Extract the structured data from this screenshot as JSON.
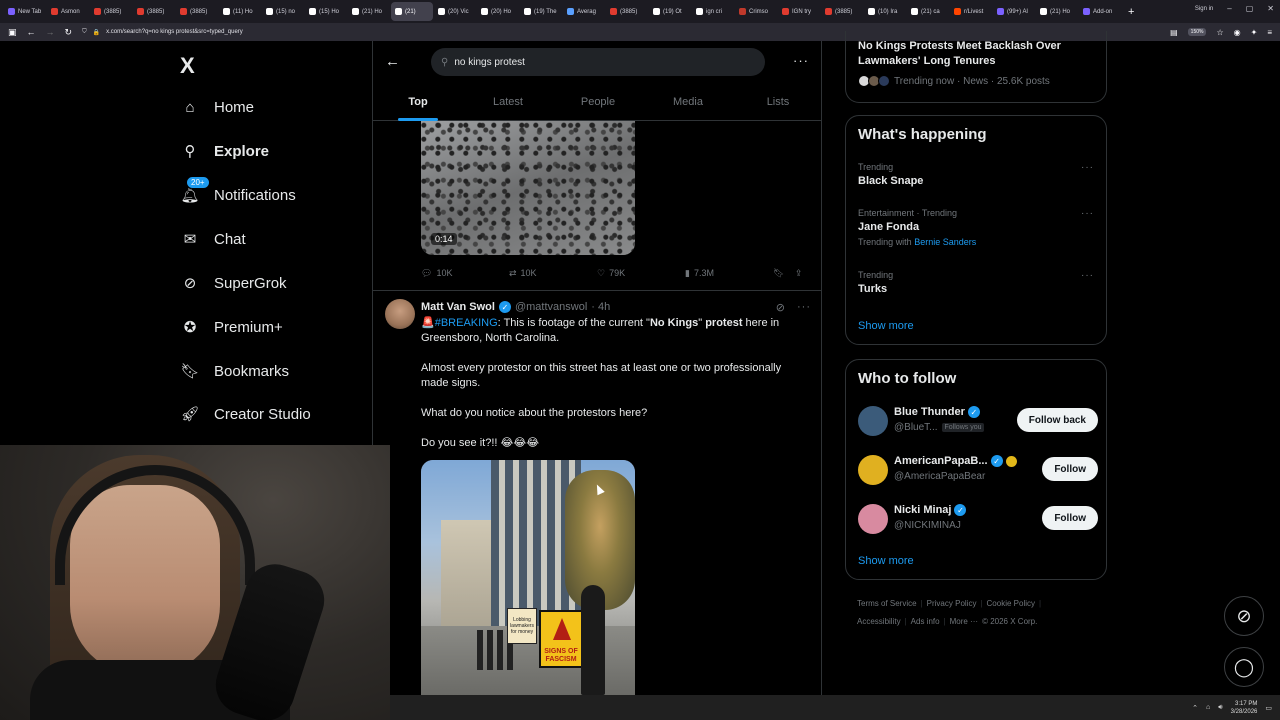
{
  "browser": {
    "tabs": [
      {
        "label": "New Tab",
        "color": "#7b61ff"
      },
      {
        "label": "Asmon",
        "color": "#e03b2f"
      },
      {
        "label": "(3885)",
        "color": "#e03b2f"
      },
      {
        "label": "(3885)",
        "color": "#e03b2f"
      },
      {
        "label": "(3885)",
        "color": "#e03b2f"
      },
      {
        "label": "(11) Ho",
        "color": "#ffffff"
      },
      {
        "label": "(15) no",
        "color": "#ffffff"
      },
      {
        "label": "(15) Ho",
        "color": "#ffffff"
      },
      {
        "label": "(21) Ho",
        "color": "#ffffff"
      },
      {
        "label": "(21)",
        "color": "#ffffff",
        "active": true
      },
      {
        "label": "(20) Vic",
        "color": "#ffffff"
      },
      {
        "label": "(20) Ho",
        "color": "#ffffff"
      },
      {
        "label": "(19) The",
        "color": "#ffffff"
      },
      {
        "label": "Averag",
        "color": "#5aa0ff"
      },
      {
        "label": "(3885)",
        "color": "#e03b2f"
      },
      {
        "label": "(19) Ot",
        "color": "#ffffff"
      },
      {
        "label": "ign cri",
        "color": "#ffffff"
      },
      {
        "label": "Crimso",
        "color": "#c0392b"
      },
      {
        "label": "IGN try",
        "color": "#e03b2f"
      },
      {
        "label": "(3885)",
        "color": "#e03b2f"
      },
      {
        "label": "(10) Ira",
        "color": "#ffffff"
      },
      {
        "label": "(21) ca",
        "color": "#ffffff"
      },
      {
        "label": "r/Livest",
        "color": "#ff4500"
      },
      {
        "label": "(99+) Al",
        "color": "#7b61ff"
      },
      {
        "label": "(21) Ho",
        "color": "#ffffff"
      },
      {
        "label": "Add-on",
        "color": "#7b61ff"
      }
    ],
    "url": "x.com/search?q=no kings protest&src=typed_query",
    "zoom": "150%",
    "signin": "Sign in"
  },
  "nav": {
    "logo": "X",
    "items": [
      {
        "label": "Home",
        "icon": "home-icon"
      },
      {
        "label": "Explore",
        "icon": "search-icon",
        "bold": true
      },
      {
        "label": "Notifications",
        "icon": "bell-icon",
        "badge": "20+"
      },
      {
        "label": "Chat",
        "icon": "mail-icon"
      },
      {
        "label": "SuperGrok",
        "icon": "grok-icon"
      },
      {
        "label": "Premium+",
        "icon": "premium-icon"
      },
      {
        "label": "Bookmarks",
        "icon": "bookmark-icon"
      },
      {
        "label": "Creator Studio",
        "icon": "rocket-icon"
      }
    ]
  },
  "search": {
    "query": "no kings protest",
    "tabs": [
      "Top",
      "Latest",
      "People",
      "Media",
      "Lists"
    ],
    "active_tab": "Top"
  },
  "prev_tweet": {
    "video_time": "0:14",
    "replies": "10K",
    "reposts": "10K",
    "likes": "79K",
    "views": "7.3M"
  },
  "tweet": {
    "name": "Matt Van Swol",
    "handle": "@mattvanswol",
    "time": "· 4h",
    "hashtag": "#BREAKING",
    "line1_a": ": This is footage of the current \"",
    "line1_b": "No Kings",
    "line1_c": "\" ",
    "line1_d": "protest",
    "line1_e": " here in Greensboro, North Carolina.",
    "p2": "Almost every protestor on this street has at least one or two professionally made signs.",
    "p3": "What do you notice about the protestors here?",
    "p4": "Do you see it?!! 😂😂😂",
    "sign_text": "SIGNS OF FASCISM",
    "sign2_text": "Lobbing lawmakers for money"
  },
  "right": {
    "top_trend": {
      "title": "No Kings Protests Meet Backlash Over Lawmakers' Long Tenures",
      "meta": "Trending now · News · 25.6K posts"
    },
    "happening_title": "What's happening",
    "trends": [
      {
        "context": "Trending",
        "name": "Black Snape"
      },
      {
        "context": "Entertainment · Trending",
        "name": "Jane Fonda",
        "with_prefix": "Trending with",
        "with_link": "Bernie Sanders"
      },
      {
        "context": "Trending",
        "name": "Turks"
      }
    ],
    "show_more": "Show more",
    "who_title": "Who to follow",
    "who": [
      {
        "name": "Blue Thunder",
        "handle": "@BlueT...",
        "follows_you": "Follows you",
        "button": "Follow back",
        "color": "#3b5b7a"
      },
      {
        "name": "AmericanPapaB...",
        "handle": "@AmericaPapaBear",
        "button": "Follow",
        "color": "#e0b020"
      },
      {
        "name": "Nicki Minaj",
        "handle": "@NICKIMINAJ",
        "button": "Follow",
        "color": "#d88aa0"
      }
    ],
    "footer": [
      "Terms of Service",
      "Privacy Policy",
      "Cookie Policy",
      "Accessibility",
      "Ads info",
      "More ···",
      "© 2026 X Corp."
    ]
  },
  "taskbar": {
    "time": "3:17 PM",
    "date": "3/28/2026"
  }
}
